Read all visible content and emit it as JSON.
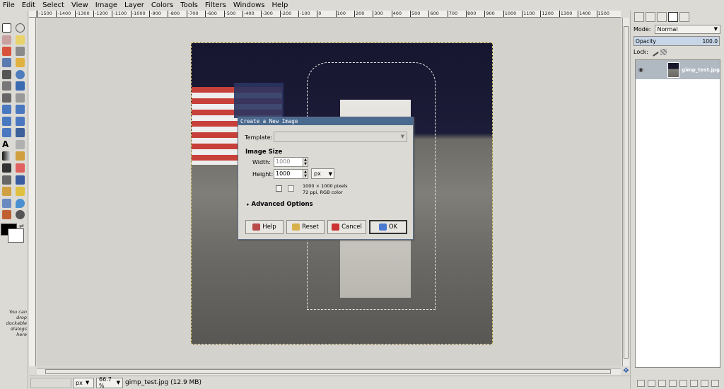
{
  "menubar": {
    "items": [
      "File",
      "Edit",
      "Select",
      "View",
      "Image",
      "Layer",
      "Colors",
      "Tools",
      "Filters",
      "Windows",
      "Help"
    ]
  },
  "ruler": {
    "labels": [
      "-1500",
      "-1400",
      "-1300",
      "-1200",
      "-1100",
      "-1000",
      "-900",
      "-800",
      "-700",
      "-600",
      "-500",
      "-400",
      "-300",
      "-200",
      "-100",
      "0",
      "100",
      "200",
      "300",
      "400",
      "500",
      "600",
      "700",
      "800",
      "900",
      "1000",
      "1100",
      "1200",
      "1300",
      "1400",
      "1500"
    ]
  },
  "toolbox": {
    "dropnote": "You can drop dockable dialogs here"
  },
  "statusbar": {
    "unit": "px",
    "zoom": "66.7 %",
    "text": "gimp_test.jpg (12.9 MB)"
  },
  "dock": {
    "mode_label": "Mode:",
    "mode_value": "Normal",
    "opacity_label": "Opacity",
    "opacity_value": "100.0",
    "lock_label": "Lock:",
    "layer_name": "gimp_test.jpg"
  },
  "dialog": {
    "title": "Create a New Image",
    "template_label": "Template:",
    "template_value": "",
    "image_size_label": "Image Size",
    "width_label": "Width:",
    "width_value": "1000",
    "height_label": "Height:",
    "height_value": "1000",
    "unit": "px",
    "info_line1": "1000 × 1000 pixels",
    "info_line2": "72 ppi, RGB color",
    "advanced_label": "Advanced Options",
    "buttons": {
      "help": "Help",
      "reset": "Reset",
      "cancel": "Cancel",
      "ok": "OK"
    }
  },
  "colors": {
    "selection": "#4b6a8f",
    "flag_red": "#c7413a",
    "flag_blue": "#2a3460"
  }
}
